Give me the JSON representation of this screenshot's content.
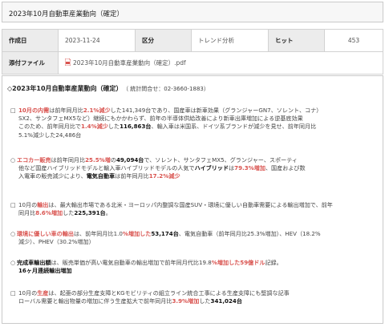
{
  "title": "2023年10月自動車産業動向（確定）",
  "meta": {
    "author_label": "作成日",
    "date": "2023-11-24",
    "category_label": "区分",
    "category_value": "トレンド分析",
    "hits_label": "ヒット",
    "hits_value": "453",
    "attachment_label": "添付ファイル",
    "attachment_value": "2023年10月自動車産業動向（確定）.pdf"
  },
  "heading": {
    "title": "◇2023年10月自動車産業動向（確定）",
    "contact": "（ 統計問合せ：02-3660-1883）"
  },
  "p1": {
    "a1": "10月の内需",
    "a2": "は前年同月比",
    "a3": "2.1%減少",
    "a4": "した141,349台であり、国産車は新車効果（グランジャーGN7、ソレント、コナ）",
    "b1": "SX2、サンタフェMX5など）継続にもかかわらず、前年の半導体供給改善により新車出庫増加による逆基底効果",
    "c1": "このため、前年同月比で",
    "c2": "1.4%減少",
    "c3": "した",
    "c4": "116,863台",
    "c5": "、輸入車は米国系、ドイツ系ブランドが減少を見せ、前年同月比",
    "d1": "5.1%減少した24,486台"
  },
  "p2": {
    "a1": "エコカー販売",
    "a2": "は前年同月比",
    "a3": "25.5%増",
    "a4": "の",
    "a5": "49,094台",
    "a6": "で、ソレント、サンタフェMX5、グランジャー、スポーティ",
    "b1": "他など国産ハイブリッドモデルと輸入車ハイブリッドモデルの人気で",
    "b2": "ハイブリッド",
    "b3": "は",
    "b4": "79.3%増加",
    "b5": "、国産および数",
    "c1": "入電車の販売減少により、",
    "c2": "電気自動車",
    "c3": "は前年同月比",
    "c4": "17.2%減少"
  },
  "p3": {
    "a1": "10月の",
    "a2": "輸出",
    "a3": "は、最大輸出市場である北米・ヨーロッパ内整調な国産SUV・環境に優しい自動車需要による輸出増加で、前年",
    "b1": "同月比",
    "b2": "8.6%増加",
    "b3": "した",
    "b4": "225,391台",
    "b5": "。"
  },
  "p4": {
    "a1": "環境に優しい車の輸出",
    "a2": "は、前年同月比1.0",
    "a3": "%増加した",
    "a4": "53,174台",
    "a5": "、電気自動車（前年同月比25.3%増加）、HEV（18.2%",
    "b1": "減少）、PHEV（30.2%増加）"
  },
  "p5": {
    "a1": "完成車輸出額",
    "a2": "は、販売単価が高い電気自動車の輸出増加で前年同月代比19.8",
    "a3": "%増加した59億ドル",
    "a4": "記録。",
    "b1": "16ヶ月連続輸出増加"
  },
  "p6": {
    "a1": "10月の",
    "a2": "生産",
    "a3": "は、起亜の部分生産支障とKGモビリティの組立ライン統合工事による生産支障にも堅調な記事",
    "b1": "ローバル需要と輸出物量の増加に伴う生産拡大で前年同月比",
    "b2": "3.9%増加",
    "b3": "した",
    "b4": "341,024台"
  },
  "colors": {
    "accent_red": "#d9534f",
    "pdf_red": "#d9534f"
  }
}
